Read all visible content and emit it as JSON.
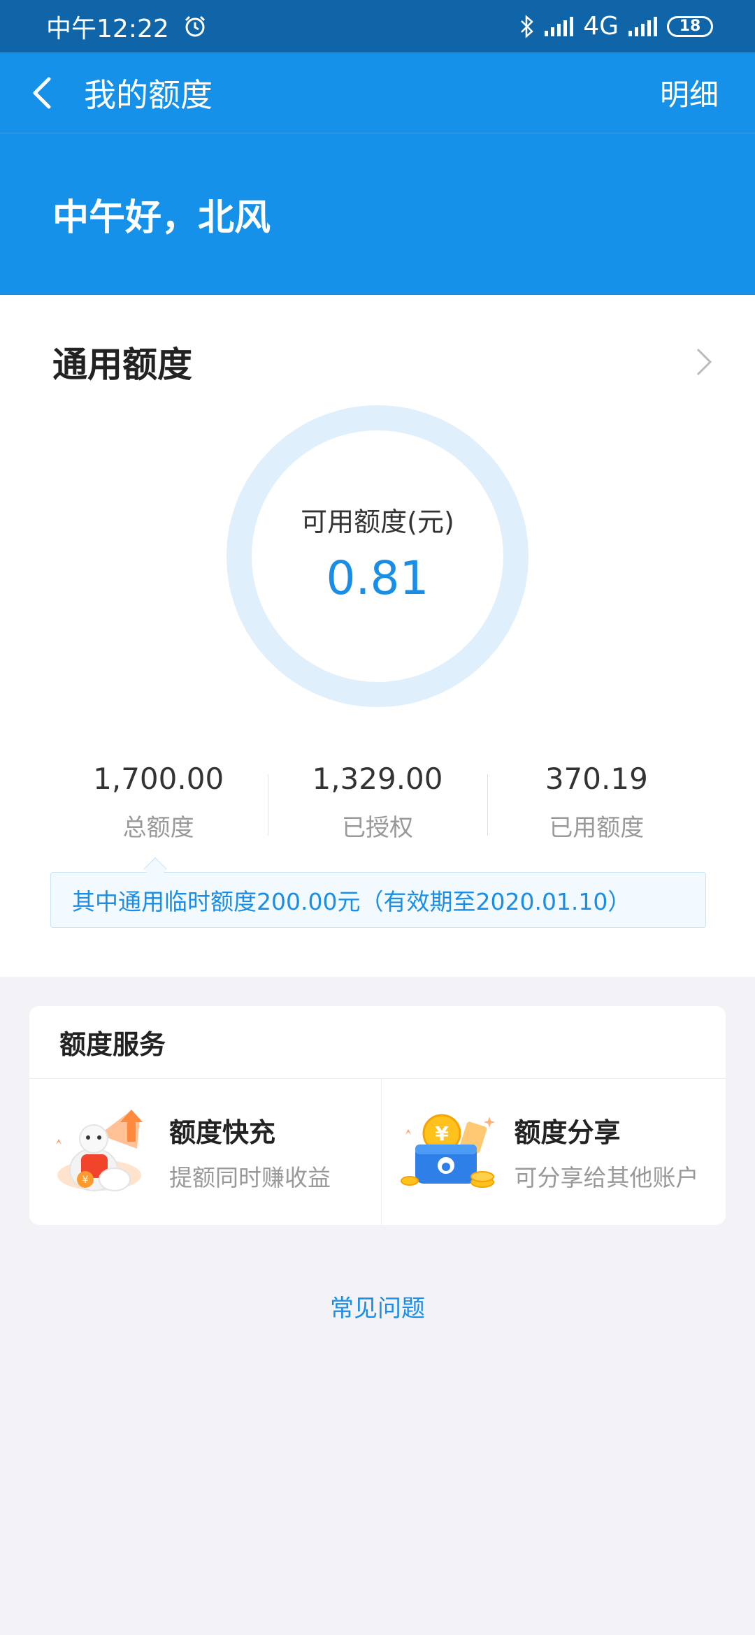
{
  "status_bar": {
    "time": "中午12:22",
    "network": "4G",
    "battery": "18"
  },
  "app_bar": {
    "title": "我的额度",
    "detail_label": "明细"
  },
  "greeting": "中午好，北风",
  "quota": {
    "title": "通用额度",
    "ring_label": "可用额度(元)",
    "available": "0.81",
    "stats": [
      {
        "value": "1,700.00",
        "label": "总额度"
      },
      {
        "value": "1,329.00",
        "label": "已授权"
      },
      {
        "value": "370.19",
        "label": "已用额度"
      }
    ],
    "tip": "其中通用临时额度200.00元（有效期至2020.01.10）"
  },
  "services": {
    "title": "额度服务",
    "items": [
      {
        "name": "额度快充",
        "desc": "提额同时赚收益",
        "icon": "mascot-boost-icon"
      },
      {
        "name": "额度分享",
        "desc": "可分享给其他账户",
        "icon": "wallet-share-icon"
      }
    ]
  },
  "faq_label": "常见问题",
  "colors": {
    "primary": "#1691e9",
    "status_bar": "#0f65a8",
    "accent_text": "#1a8ee6",
    "ring": "#dff0fc"
  }
}
